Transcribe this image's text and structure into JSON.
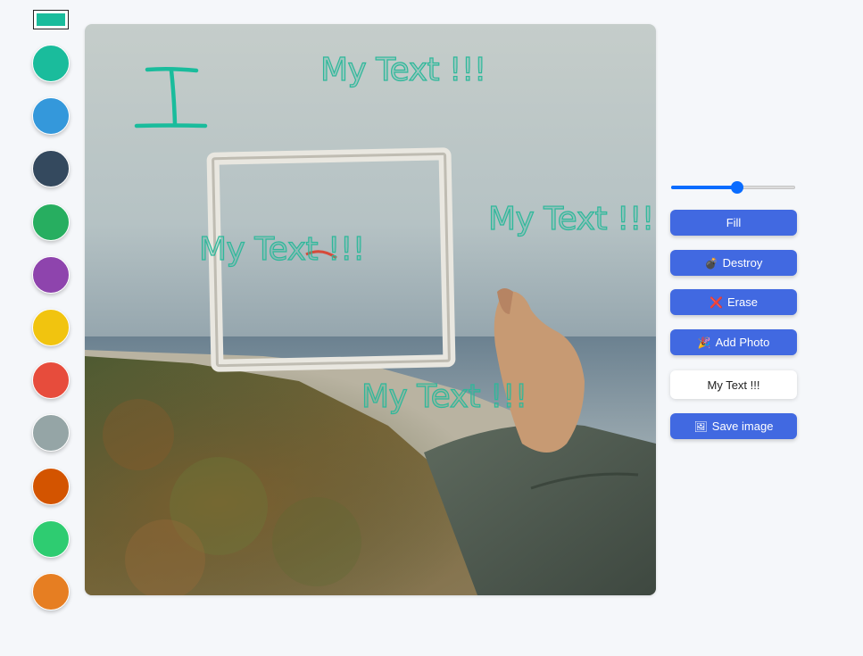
{
  "selected_color": "#1abc9c",
  "palette": [
    {
      "name": "turquoise",
      "color": "#1abc9c"
    },
    {
      "name": "blue",
      "color": "#3498db"
    },
    {
      "name": "dark-blue",
      "color": "#34495e"
    },
    {
      "name": "green",
      "color": "#27ae60"
    },
    {
      "name": "purple",
      "color": "#8e44ad"
    },
    {
      "name": "yellow",
      "color": "#f1c40f"
    },
    {
      "name": "red",
      "color": "#e74c3c"
    },
    {
      "name": "gray",
      "color": "#95a5a6"
    },
    {
      "name": "dark-orange",
      "color": "#d35400"
    },
    {
      "name": "light-green",
      "color": "#2ecc71"
    },
    {
      "name": "orange",
      "color": "#e67e22"
    }
  ],
  "canvas": {
    "text_items": [
      "My Text !!!",
      "My Text !!!",
      "My Text !!!",
      "My Text !!!"
    ],
    "stroke_color": "#1abc9c"
  },
  "brush_size": {
    "fraction": 0.53
  },
  "buttons": {
    "fill": {
      "label": "Fill"
    },
    "destroy": {
      "label": "Destroy",
      "icon": "💣"
    },
    "erase": {
      "label": "Erase",
      "icon": "❌"
    },
    "add_photo": {
      "label": "Add Photo",
      "icon": "🎉"
    },
    "text_input": {
      "value": "My Text !!!"
    },
    "save": {
      "label": "Save image",
      "icon": "🖼"
    }
  }
}
